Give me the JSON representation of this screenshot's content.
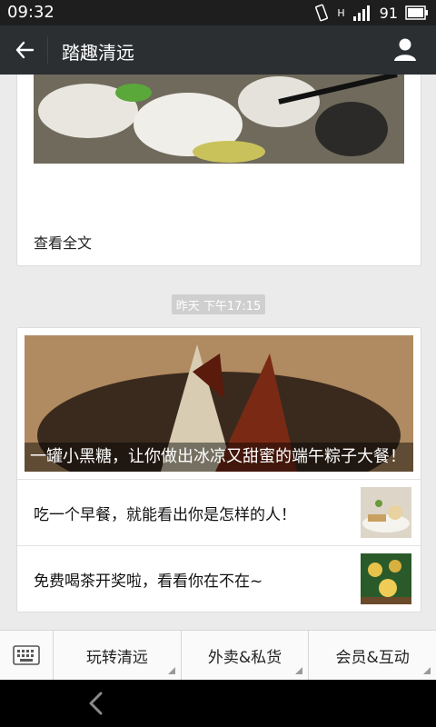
{
  "status_bar": {
    "time": "09:32",
    "signal_label": "H",
    "battery": "91"
  },
  "header": {
    "title": "踏趣清远"
  },
  "article_card": {
    "read_all": "查看全文"
  },
  "timestamp": "昨天 下午17:15",
  "news_card": {
    "hero_title": "一罐小黑糖，让你做出冰凉又甜蜜的端午粽子大餐！",
    "items": [
      {
        "label": "吃一个早餐，就能看出你是怎样的人！"
      },
      {
        "label": "免费喝茶开奖啦，看看你在不在~"
      }
    ]
  },
  "bottom_menu": {
    "items": [
      {
        "label": "玩转清远"
      },
      {
        "label": "外卖&私货"
      },
      {
        "label": "会员&互动"
      }
    ]
  },
  "icons": {
    "back": "back-arrow-icon",
    "user": "user-icon",
    "keyboard": "keyboard-icon",
    "vibrate": "vibrate-icon",
    "signal": "signal-icon",
    "battery": "battery-icon",
    "nav_back": "nav-back-icon"
  },
  "colors": {
    "status_bar": "#1e1e1e",
    "header": "#2b2f32",
    "background": "#ebebeb"
  }
}
